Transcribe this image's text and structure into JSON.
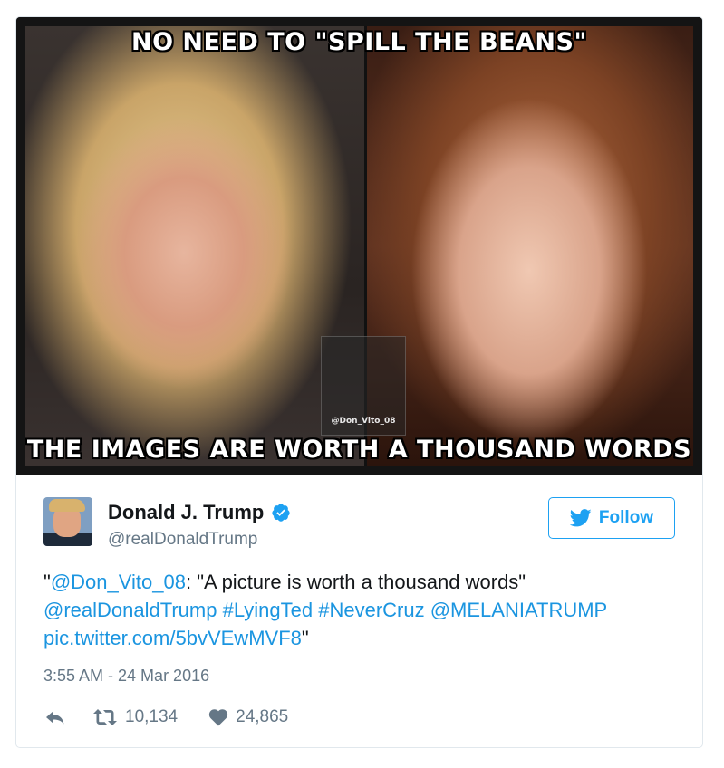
{
  "meme": {
    "top_caption": "NO NEED TO \"SPILL THE BEANS\"",
    "bottom_caption": "THE IMAGES ARE WORTH A THOUSAND WORDS",
    "watermark": "@Don_Vito_08"
  },
  "author": {
    "display_name": "Donald J. Trump",
    "handle": "@realDonaldTrump",
    "verified_icon": "verified-badge-icon"
  },
  "follow_button": {
    "label": "Follow",
    "icon": "twitter-bird-icon"
  },
  "tweet": {
    "q_open": "\"",
    "mention_1": "@Don_Vito_08",
    "quote_text": ": \"A picture is worth a thousand words\"",
    "mention_2": "@realDonaldTrump",
    "hashtag_1": "#LyingTed",
    "hashtag_2": "#NeverCruz",
    "mention_3": "@MELANIATRUMP",
    "link": "pic.twitter.com/5bvVEwMVF8",
    "q_close": "\""
  },
  "timestamp": "3:55 AM - 24 Mar 2016",
  "actions": {
    "reply_icon": "reply-icon",
    "retweet_icon": "retweet-icon",
    "retweet_count": "10,134",
    "like_icon": "heart-icon",
    "like_count": "24,865"
  },
  "colors": {
    "link": "#1b95e0",
    "follow": "#1da1f2",
    "muted": "#657786",
    "text": "#14171a"
  }
}
